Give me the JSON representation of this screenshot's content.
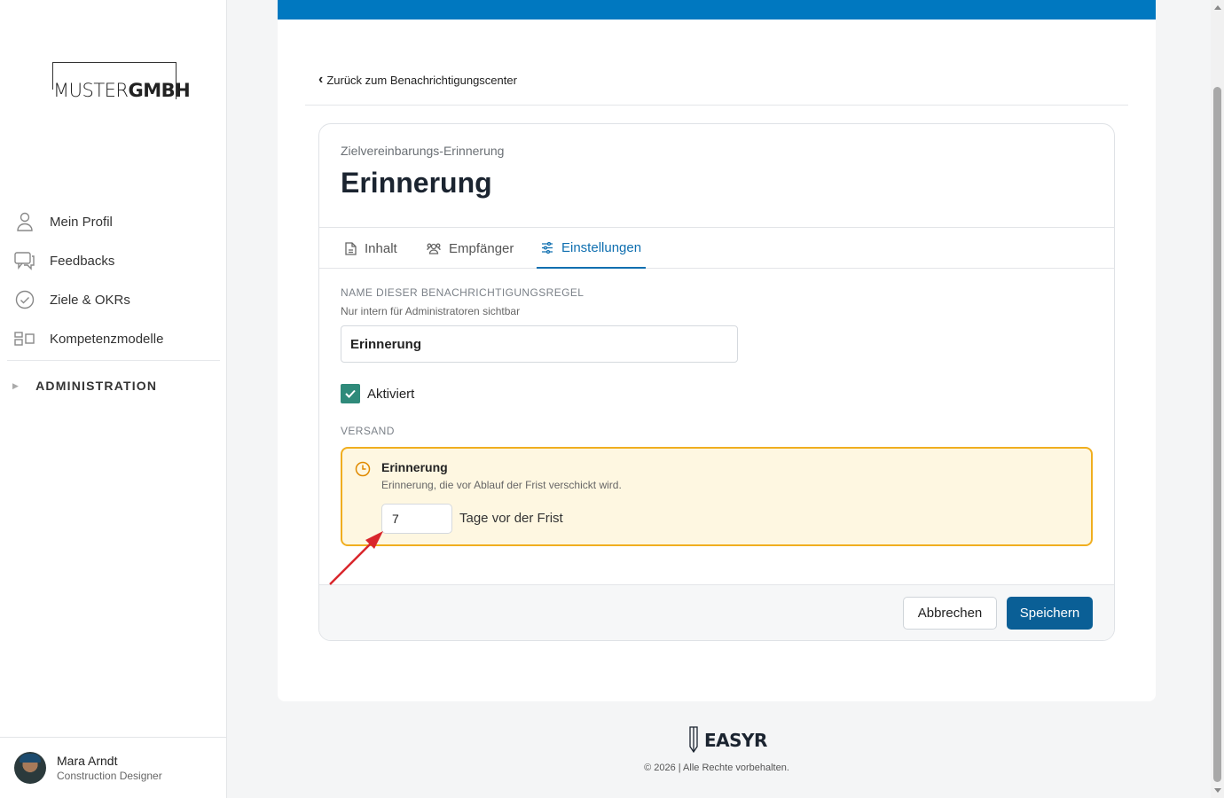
{
  "brand": {
    "logo_light": "MUSTER",
    "logo_bold": "GMBH"
  },
  "sidebar": {
    "items": [
      {
        "label": "Mein Profil",
        "icon": "user-icon"
      },
      {
        "label": "Feedbacks",
        "icon": "chat-icon"
      },
      {
        "label": "Ziele & OKRs",
        "icon": "check-circle-icon"
      },
      {
        "label": "Kompetenzmodelle",
        "icon": "grid-icon"
      }
    ],
    "admin_label": "ADMINISTRATION"
  },
  "user": {
    "name": "Mara Arndt",
    "role": "Construction Designer"
  },
  "page": {
    "back_link": "Zurück zum Benachrichtigungscenter",
    "subtitle": "Zielvereinbarungs-Erinnerung",
    "title": "Erinnerung"
  },
  "tabs": [
    {
      "label": "Inhalt",
      "icon": "document-icon",
      "active": false
    },
    {
      "label": "Empfänger",
      "icon": "users-icon",
      "active": false
    },
    {
      "label": "Einstellungen",
      "icon": "sliders-icon",
      "active": true
    }
  ],
  "form": {
    "name_label": "NAME DIESER BENACHRICHTIGUNGSREGEL",
    "name_hint": "Nur intern für Administratoren sichtbar",
    "name_value": "Erinnerung",
    "activated_label": "Aktiviert",
    "activated": true,
    "shipping_label": "VERSAND",
    "reminder_title": "Erinnerung",
    "reminder_desc": "Erinnerung, die vor Ablauf der Frist verschickt wird.",
    "days_value": "7",
    "days_suffix": "Tage vor der Frist"
  },
  "actions": {
    "cancel": "Abbrechen",
    "save": "Speichern"
  },
  "footer": {
    "brand": "EASYR",
    "copyright": "© 2026 | Alle Rechte vorbehalten."
  },
  "colors": {
    "accent": "#0078c0",
    "primary_button": "#0a5f96",
    "checkbox": "#2f8a7a",
    "warning_border": "#f0ae1f",
    "warning_bg": "#fef7e1",
    "annotation_arrow": "#d9262c"
  }
}
